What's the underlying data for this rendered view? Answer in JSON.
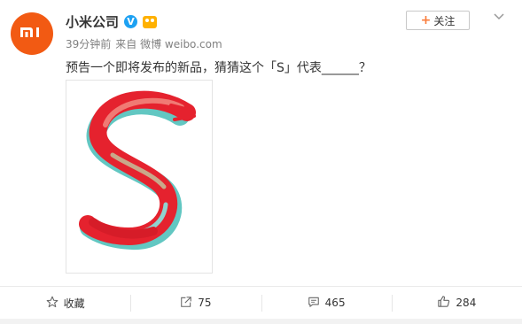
{
  "avatar": {
    "logo_text": "mi",
    "color": "#f25a13"
  },
  "author": {
    "name": "小米公司",
    "verified_icon": "verified-icon",
    "vip_icon": "vip-icon"
  },
  "meta": {
    "time": "39分钟前",
    "source": "来自 微博 weibo.com"
  },
  "follow_button": {
    "icon": "plus-icon",
    "label": "关注"
  },
  "menu_icon": "chevron-down-icon",
  "post": {
    "text": "预告一个即将发布的新品，猜猜这个「S」代表______？"
  },
  "image": {
    "description_icon": "s-brushstroke-image"
  },
  "actions": [
    {
      "icon": "star-icon",
      "label": "收藏"
    },
    {
      "icon": "share-icon",
      "label": "75"
    },
    {
      "icon": "comment-icon",
      "label": "465"
    },
    {
      "icon": "like-icon",
      "label": "284"
    }
  ],
  "colors": {
    "accent": "#fa7d3c",
    "text": "#333333",
    "meta": "#808080"
  }
}
